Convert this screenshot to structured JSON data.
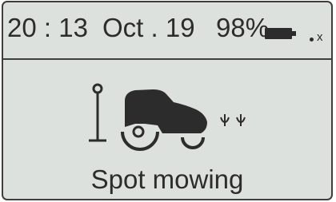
{
  "status_bar": {
    "time": "20 : 13",
    "date": "Oct . 19",
    "battery_percent": "98%",
    "battery_icon": "battery-full-icon",
    "signal_icon": "no-signal-icon",
    "signal_text": "x"
  },
  "main": {
    "illustration_icons": [
      "station-post-icon",
      "robot-mower-icon",
      "grass-icon"
    ],
    "mode_label": "Spot mowing"
  },
  "colors": {
    "screen_background": "#dde1dd",
    "foreground": "#2c2c2c",
    "border": "#3e3e3e"
  }
}
